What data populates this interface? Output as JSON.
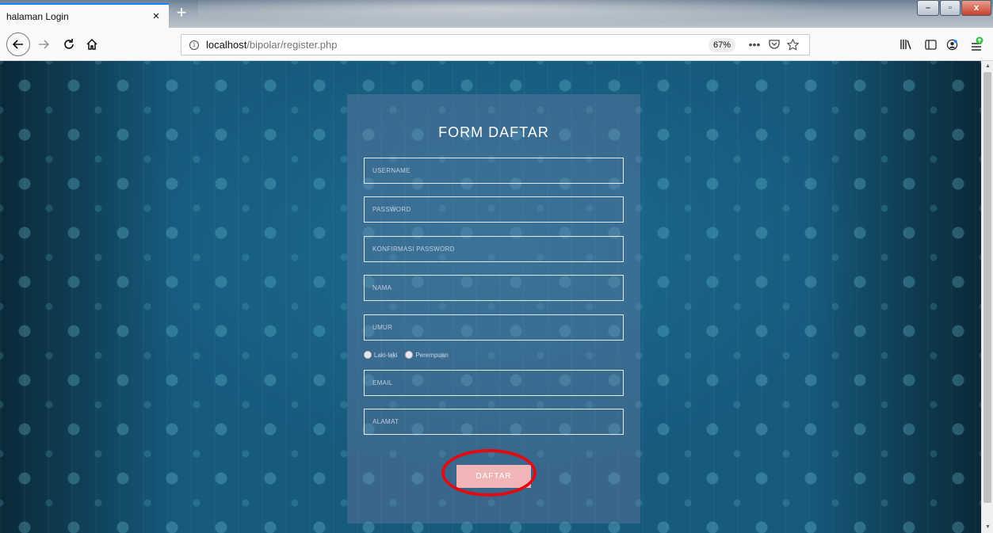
{
  "browser": {
    "tab_title": "halaman Login",
    "tab_close": "×",
    "new_tab": "+",
    "url_host": "localhost",
    "url_path": "/bipolar/register.php",
    "zoom": "67%",
    "page_actions": "•••",
    "window_controls": {
      "minimize": "–",
      "maximize": "▫",
      "close": "x"
    }
  },
  "icons": {
    "back": "back-arrow-icon",
    "forward": "forward-arrow-icon",
    "reload": "reload-icon",
    "home": "home-icon",
    "info": "info-icon",
    "pocket": "pocket-icon",
    "bookmark": "star-icon",
    "library": "library-icon",
    "sidebar": "sidebar-icon",
    "account": "account-icon",
    "menu": "menu-update-icon"
  },
  "form": {
    "title": "FORM DAFTAR",
    "username_placeholder": "USERNAME",
    "password_placeholder": "PASSWORD",
    "confirm_password_placeholder": "KONFIRMASI PASSWORD",
    "name_placeholder": "NAMA",
    "age_placeholder": "UMUR",
    "gender_options": [
      "Laki-laki",
      "Perempuan"
    ],
    "email_placeholder": "EMAIL",
    "address_placeholder": "ALAMAT",
    "submit_label": "DAFTAR"
  },
  "colors": {
    "page_background": "#165a7c",
    "button": "#efb5b7",
    "highlight_ring": "#e30b13",
    "tab_accent": "#0a84ff"
  }
}
